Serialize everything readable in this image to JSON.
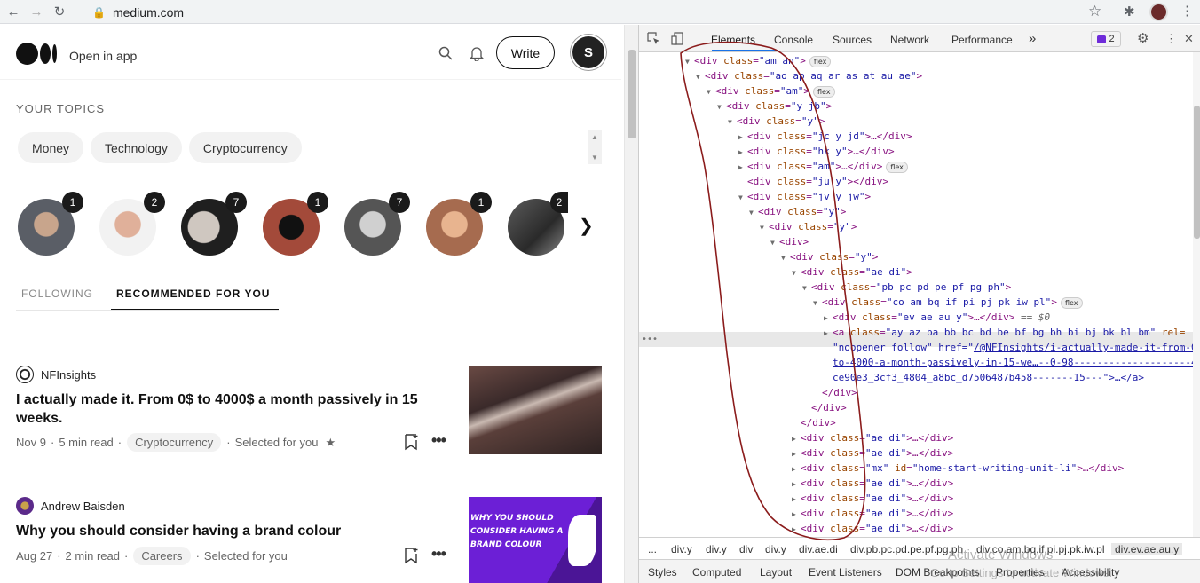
{
  "browser": {
    "url": "medium.com"
  },
  "medium": {
    "open_in_app": "Open in app",
    "write_label": "Write",
    "avatar_letter": "S",
    "your_topics": "YOUR TOPICS",
    "topics": [
      "Money",
      "Technology",
      "Cryptocurrency"
    ],
    "authors": [
      {
        "count": "1",
        "color": "#5a5e66"
      },
      {
        "count": "2",
        "color": "#b98a7a"
      },
      {
        "count": "7",
        "color": "#2d2d2d"
      },
      {
        "count": "1",
        "color": "#a34a3a"
      },
      {
        "count": "7",
        "color": "#7a7a7a"
      },
      {
        "count": "1",
        "color": "#a66b4f"
      },
      {
        "count": "2",
        "color": "#3b3b3b"
      }
    ],
    "tab_following": "FOLLOWING",
    "tab_recommended": "RECOMMENDED FOR YOU",
    "articles": [
      {
        "publication": "NFInsights",
        "title": "I actually made it. From 0$ to 4000$ a month passively in 15 weeks.",
        "date": "Nov 9",
        "read_time": "5 min read",
        "tag": "Cryptocurrency",
        "selected": "Selected for you",
        "star": "★"
      },
      {
        "publication": "Andrew Baisden",
        "title": "Why you should consider having a brand colour",
        "date": "Aug 27",
        "read_time": "2 min read",
        "tag": "Careers",
        "selected": "Selected for you",
        "thumb_text": [
          "WHY YOU SHOULD",
          "CONSIDER HAVING A",
          "BRAND COLOUR"
        ]
      }
    ]
  },
  "devtools": {
    "tabs": [
      "Elements",
      "Console",
      "Sources",
      "Network",
      "Performance"
    ],
    "more_tabs": "»",
    "issues_count": "2",
    "breadcrumbs": [
      "...",
      "div.y",
      "div.y",
      "div",
      "div.y",
      "div.ae.di",
      "div.pb.pc.pd.pe.pf.pg.ph",
      "div.co.am.bq.if.pi.pj.pk.iw.pl",
      "div.ev.ae.au.y"
    ],
    "subtabs": [
      "Styles",
      "Computed",
      "Layout",
      "Event Listeners",
      "DOM Breakpoints",
      "Properties",
      "Accessibility"
    ],
    "watermark_line1": "Activate Windows",
    "watermark_line2": "Go to Settings to activate Windows.",
    "selected_suffix": "== $0",
    "selected_dots": "•••",
    "flex_badge": "flex"
  },
  "dom_lines": [
    {
      "indent": 0,
      "tri": "open",
      "tag": "div",
      "cls": "am an",
      "end": "",
      "flex": true
    },
    {
      "indent": 1,
      "tri": "open",
      "tag": "div",
      "cls": "ao ap aq ar as at au ae",
      "end": ""
    },
    {
      "indent": 2,
      "tri": "open",
      "tag": "div",
      "cls": "am",
      "end": "",
      "flex": true
    },
    {
      "indent": 3,
      "tri": "open",
      "tag": "div",
      "cls": "y jb",
      "end": ""
    },
    {
      "indent": 4,
      "tri": "open",
      "tag": "div",
      "cls": "y",
      "end": ""
    },
    {
      "indent": 5,
      "tri": "closed",
      "tag": "div",
      "cls": "jc y jd",
      "end": "…</div>"
    },
    {
      "indent": 5,
      "tri": "closed",
      "tag": "div",
      "cls": "hk y",
      "end": "…</div>"
    },
    {
      "indent": 5,
      "tri": "closed",
      "tag": "div",
      "cls": "am",
      "end": "…</div>",
      "flex": true
    },
    {
      "indent": 5,
      "tri": "none",
      "tag": "div",
      "cls": "ju y",
      "end": "</div>"
    },
    {
      "indent": 5,
      "tri": "open",
      "tag": "div",
      "cls": "jv y jw",
      "end": ""
    },
    {
      "indent": 6,
      "tri": "open",
      "tag": "div",
      "cls": "y",
      "end": ""
    },
    {
      "indent": 7,
      "tri": "open",
      "tag": "div",
      "cls": "y",
      "end": ""
    },
    {
      "indent": 8,
      "tri": "open",
      "tag": "div",
      "cls": null,
      "end": ""
    },
    {
      "indent": 9,
      "tri": "open",
      "tag": "div",
      "cls": "y",
      "end": ""
    },
    {
      "indent": 10,
      "tri": "open",
      "tag": "div",
      "cls": "ae di",
      "end": ""
    },
    {
      "indent": 11,
      "tri": "open",
      "tag": "div",
      "cls": "pb pc pd pe pf pg ph",
      "end": ""
    },
    {
      "indent": 12,
      "tri": "open",
      "tag": "div",
      "cls": "co am bq if pi pj pk iw pl",
      "end": "",
      "flex": true
    },
    {
      "indent": 13,
      "tri": "closed",
      "tag": "div",
      "cls": "ev ae au y",
      "end": "…</div>",
      "selected": true
    },
    {
      "indent": 13,
      "tri": "closed",
      "tag": "a",
      "cls": "ay az ba bb bc bd be bf bg bh bi bj bk bl bm",
      "end": " rel=",
      "raw_extra": true
    },
    {
      "indent": 13,
      "tri": "none",
      "raw": "\"noopener follow\" href=\"",
      "link": "/@NFInsights/i-actually-made-it-from-0-",
      "after": ""
    },
    {
      "indent": 13,
      "tri": "none",
      "raw": "",
      "link": "to-4000-a-month-passively-in-15-we…--0-98--------------------4f",
      "after": ""
    },
    {
      "indent": 13,
      "tri": "none",
      "raw": "",
      "link": "ce90e3_3cf3_4804_a8bc_d7506487b458-------15---",
      "after": "\">…</a>"
    },
    {
      "indent": 12,
      "tri": "none",
      "close": "div"
    },
    {
      "indent": 11,
      "tri": "none",
      "close": "div"
    },
    {
      "indent": 10,
      "tri": "none",
      "close": "div"
    },
    {
      "indent": 10,
      "tri": "closed",
      "tag": "div",
      "cls": "ae di",
      "end": "…</div>"
    },
    {
      "indent": 10,
      "tri": "closed",
      "tag": "div",
      "cls": "ae di",
      "end": "…</div>"
    },
    {
      "indent": 10,
      "tri": "closed",
      "tag": "div",
      "cls": "mx",
      "id": "home-start-writing-unit-li",
      "end": "…</div>"
    },
    {
      "indent": 10,
      "tri": "closed",
      "tag": "div",
      "cls": "ae di",
      "end": "…</div>"
    },
    {
      "indent": 10,
      "tri": "closed",
      "tag": "div",
      "cls": "ae di",
      "end": "…</div>"
    },
    {
      "indent": 10,
      "tri": "closed",
      "tag": "div",
      "cls": "ae di",
      "end": "…</div>"
    },
    {
      "indent": 10,
      "tri": "closed",
      "tag": "div",
      "cls": "ae di",
      "end": "…</div>"
    },
    {
      "indent": 10,
      "tri": "closed",
      "tag": "div",
      "cls": "ae di",
      "end": "…</div>"
    }
  ]
}
